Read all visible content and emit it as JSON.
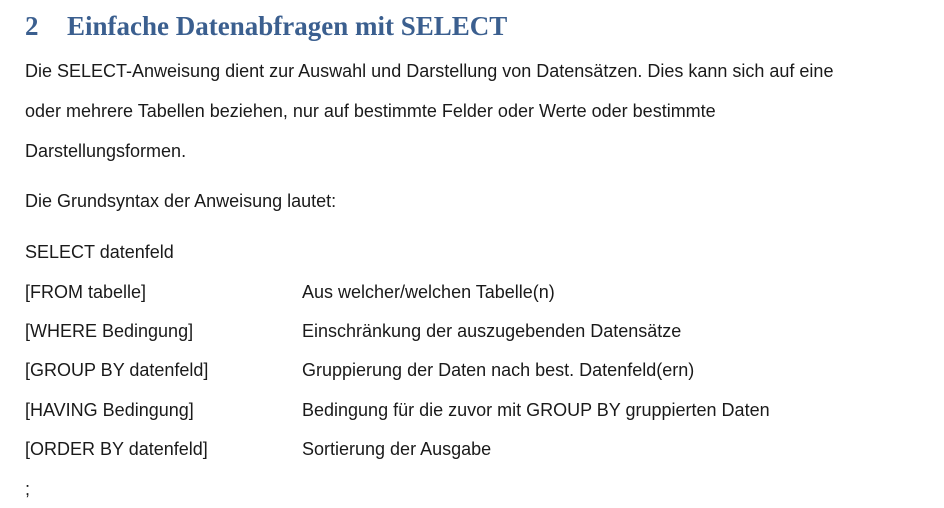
{
  "heading": {
    "number": "2",
    "title": "Einfache Datenabfragen mit SELECT"
  },
  "intro": {
    "line1": "Die SELECT-Anweisung dient zur Auswahl und Darstellung von Datensätzen. Dies kann sich auf eine",
    "line2": "oder mehrere Tabellen beziehen, nur auf bestimmte Felder oder Werte oder bestimmte",
    "line3": "Darstellungsformen."
  },
  "syntax_intro": "Die Grundsyntax der Anweisung lautet:",
  "select_line": "SELECT datenfeld",
  "syntax_rows": [
    {
      "clause": "[FROM tabelle]",
      "description": "Aus welcher/welchen Tabelle(n)"
    },
    {
      "clause": "[WHERE Bedingung]",
      "description": "Einschränkung der auszugebenden Datensätze"
    },
    {
      "clause": "[GROUP BY datenfeld]",
      "description": "Gruppierung der Daten nach best. Datenfeld(ern)"
    },
    {
      "clause": "[HAVING Bedingung]",
      "description": "Bedingung für die zuvor mit GROUP BY gruppierten Daten"
    },
    {
      "clause": "[ORDER BY datenfeld]",
      "description": "Sortierung der Ausgabe"
    }
  ],
  "terminator": ";",
  "colors": {
    "heading": "#3b5f8f",
    "text": "#1a1a1a"
  }
}
